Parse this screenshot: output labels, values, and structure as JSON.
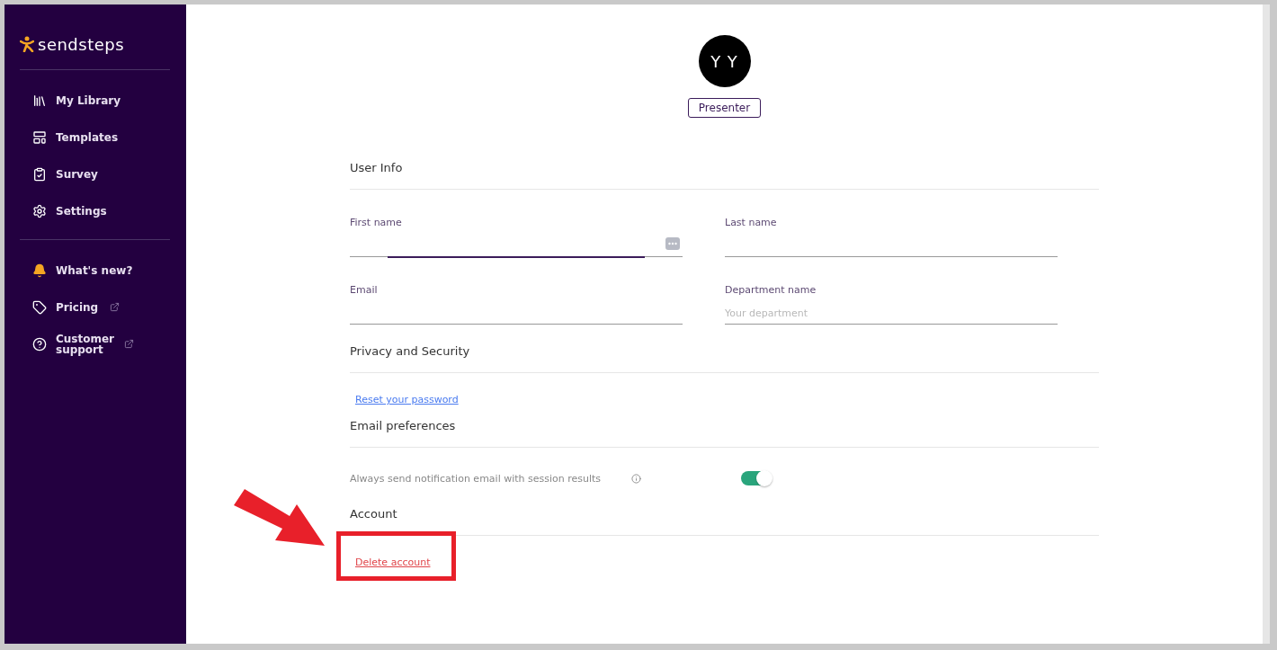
{
  "sidebar": {
    "logo": "sendsteps",
    "groups": [
      [
        {
          "label": "My Library",
          "external": false
        },
        {
          "label": "Templates",
          "external": false
        },
        {
          "label": "Survey",
          "external": false
        },
        {
          "label": "Settings",
          "external": false
        }
      ],
      [
        {
          "label": "What's new?",
          "external": false
        },
        {
          "label": "Pricing",
          "external": true
        },
        {
          "label": "Customer support",
          "external": true
        }
      ]
    ]
  },
  "profile": {
    "initials": "Y Y",
    "role": "Presenter"
  },
  "sections": [
    {
      "title": "User Info",
      "kind": "fields",
      "fields": [
        {
          "label": "First name",
          "focused": true
        },
        {
          "label": "Last name",
          "focused": false
        },
        {
          "label": "Email",
          "focused": false
        },
        {
          "label": "Department name",
          "placeholder": "Your department",
          "focused": false
        }
      ]
    },
    {
      "title": "Privacy and Security",
      "kind": "link",
      "link": "Reset your password",
      "danger": false
    },
    {
      "title": "Email preferences",
      "kind": "toggle",
      "label": "Always send notification email with session results",
      "on": true
    },
    {
      "title": "Account",
      "kind": "link",
      "link": "Delete account",
      "danger": true
    }
  ]
}
